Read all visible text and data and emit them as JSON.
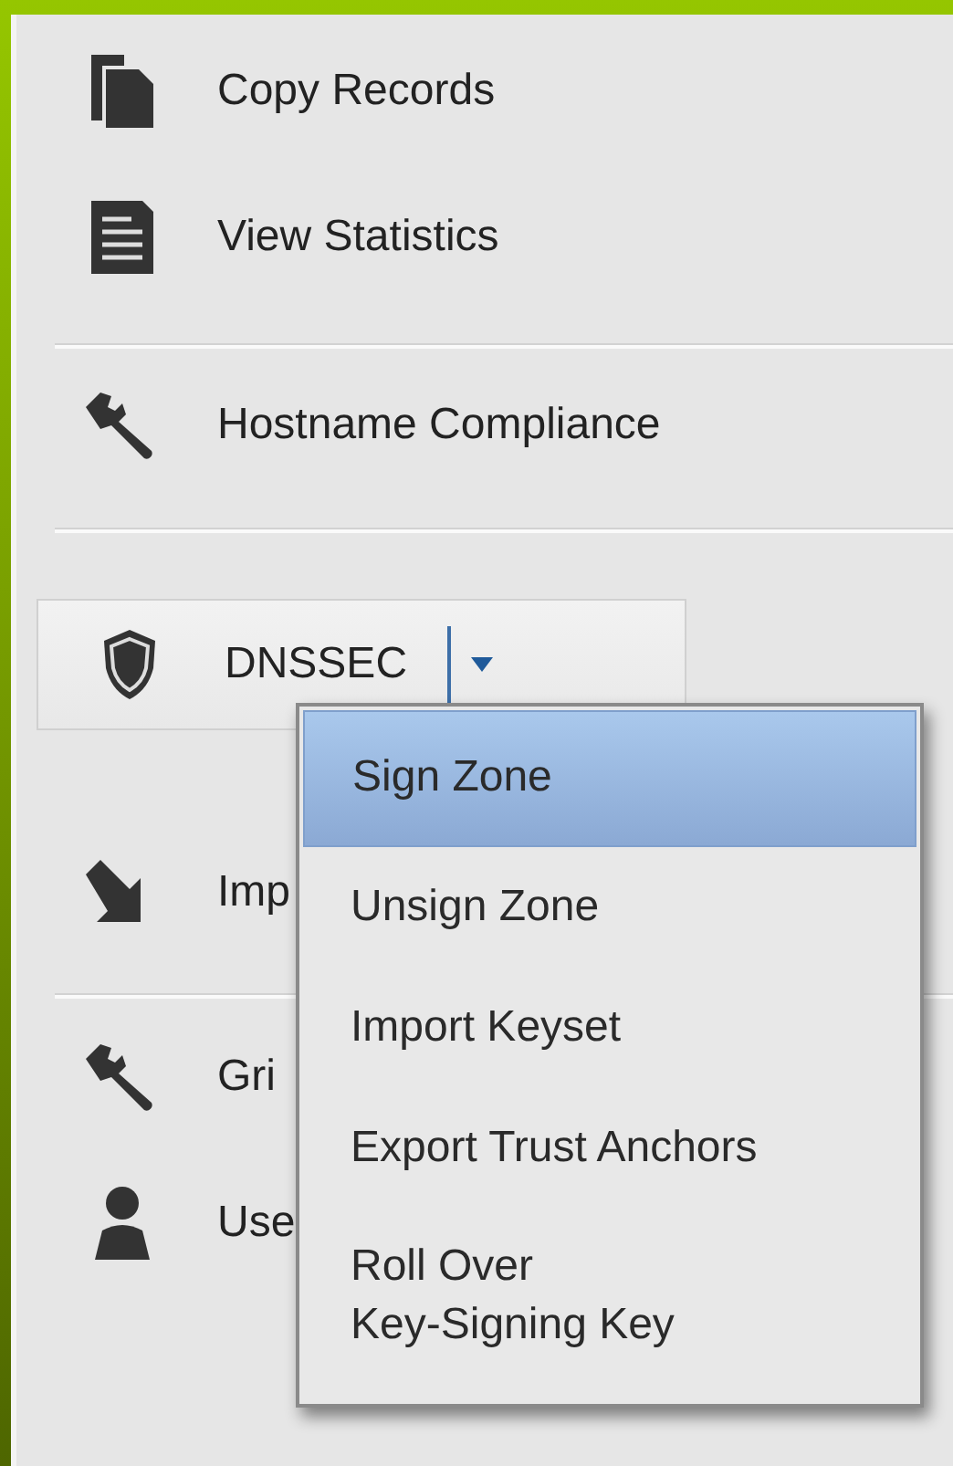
{
  "groups": [
    {
      "items": [
        {
          "kind": "item",
          "label": "Copy Records"
        },
        {
          "kind": "item",
          "label": "View Statistics"
        }
      ]
    },
    {
      "items": [
        {
          "kind": "item",
          "label": "Hostname Compliance"
        }
      ]
    },
    {
      "items": [
        {
          "kind": "split-button",
          "label": "DNSSEC",
          "expanded": true,
          "menu": [
            {
              "label": "Sign Zone",
              "selected": true
            },
            {
              "label": "Unsign Zone",
              "selected": false
            },
            {
              "label": "Import Keyset",
              "selected": false
            },
            {
              "label": "Export Trust Anchors",
              "selected": false
            },
            {
              "label": "Roll Over\nKey-Signing Key",
              "selected": false
            }
          ]
        },
        {
          "kind": "item",
          "label": "Imp"
        }
      ]
    },
    {
      "items": [
        {
          "kind": "item",
          "label": "Gri"
        },
        {
          "kind": "item",
          "label": "Use"
        }
      ]
    }
  ]
}
